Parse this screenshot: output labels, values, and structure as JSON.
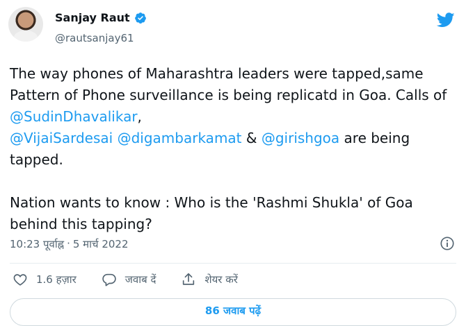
{
  "author": {
    "display_name": "Sanjay Raut",
    "handle": "@rautsanjay61",
    "verified": true
  },
  "tweet": {
    "part1": "The way phones of Maharashtra leaders were tapped,same Pattern of Phone surveillance is being replicatd in Goa. Calls of ",
    "mention1": "@SudinDhavalikar",
    "part2": ",\n",
    "mention2": "@VijaiSardesai",
    "part3": " ",
    "mention3": "@digambarkamat",
    "part4": " & ",
    "mention4": "@girishgoa",
    "part5": " are being tapped.\n\nNation wants to know : Who is the 'Rashmi Shukla' of Goa behind this tapping?"
  },
  "meta": {
    "time": "10:23 पूर्वाह्न",
    "separator": "·",
    "date": "5 मार्च 2022"
  },
  "actions": {
    "likes": "1.6 हज़ार",
    "reply_label": "जवाब दें",
    "share_label": "शेयर करें"
  },
  "replies_button": "86 जवाब पढ़ें",
  "colors": {
    "accent": "#1d9bf0",
    "text": "#0f1419",
    "secondary": "#536471"
  },
  "icons": {
    "logo": "twitter-bird-icon",
    "verified": "verified-badge-icon",
    "info": "info-icon",
    "like": "heart-icon",
    "reply": "reply-bubble-icon",
    "share": "share-icon"
  }
}
